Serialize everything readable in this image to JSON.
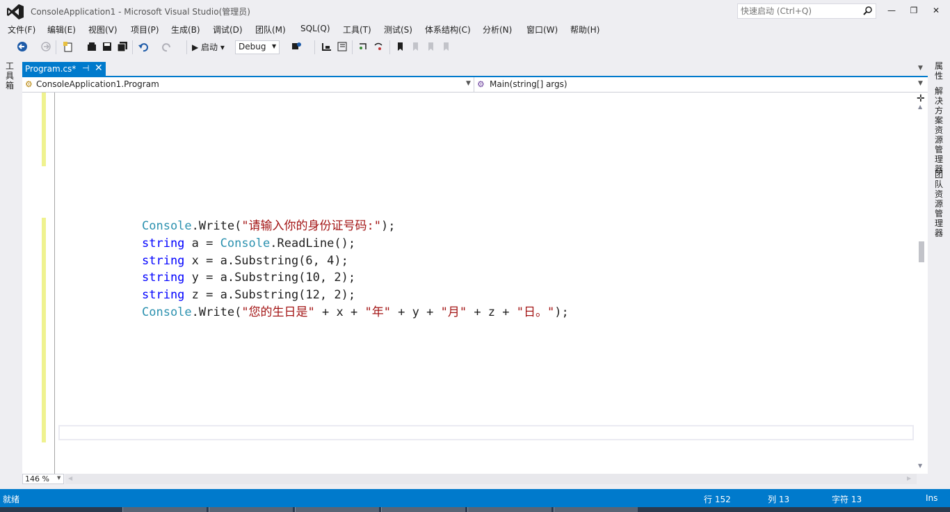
{
  "window": {
    "title": "ConsoleApplication1 - Microsoft Visual Studio(管理员)",
    "quick_launch_placeholder": "快速启动 (Ctrl+Q)",
    "minimize": "—",
    "restore": "❐",
    "close": "✕"
  },
  "menu": [
    "文件(F)",
    "编辑(E)",
    "视图(V)",
    "项目(P)",
    "生成(B)",
    "调试(D)",
    "团队(M)",
    "SQL(Q)",
    "工具(T)",
    "测试(S)",
    "体系结构(C)",
    "分析(N)",
    "窗口(W)",
    "帮助(H)"
  ],
  "toolbar": {
    "start_label": "▶ 启动 ▾",
    "configuration": "Debug"
  },
  "left_strip": {
    "toolbox": "工具箱"
  },
  "right_strip": {
    "properties": "属性",
    "solution_explorer": "解决方案资源管理器",
    "team_explorer": "团队资源管理器"
  },
  "tab": {
    "label": "Program.cs*",
    "pin": "⊣",
    "close": "✕"
  },
  "navbar": {
    "type": "ConsoleApplication1.Program",
    "member": "Main(string[] args)"
  },
  "code_lines": [
    [
      {
        "t": "Console",
        "c": "type"
      },
      {
        "t": ".Write(",
        "c": ""
      },
      {
        "t": "\"请输入你的身份证号码:\"",
        "c": "str"
      },
      {
        "t": ");",
        "c": ""
      }
    ],
    [
      {
        "t": "string",
        "c": "kw"
      },
      {
        "t": " a = ",
        "c": ""
      },
      {
        "t": "Console",
        "c": "type"
      },
      {
        "t": ".ReadLine();",
        "c": ""
      }
    ],
    [
      {
        "t": "string",
        "c": "kw"
      },
      {
        "t": " x = a.Substring(6, 4);",
        "c": ""
      }
    ],
    [
      {
        "t": "string",
        "c": "kw"
      },
      {
        "t": " y = a.Substring(10, 2);",
        "c": ""
      }
    ],
    [
      {
        "t": "string",
        "c": "kw"
      },
      {
        "t": " z = a.Substring(12, 2);",
        "c": ""
      }
    ],
    [
      {
        "t": "Console",
        "c": "type"
      },
      {
        "t": ".Write(",
        "c": ""
      },
      {
        "t": "\"您的生日是\"",
        "c": "str"
      },
      {
        "t": " + x + ",
        "c": ""
      },
      {
        "t": "\"年\"",
        "c": "str"
      },
      {
        "t": " + y + ",
        "c": ""
      },
      {
        "t": "\"月\"",
        "c": "str"
      },
      {
        "t": " + z + ",
        "c": ""
      },
      {
        "t": "\"日。\"",
        "c": "str"
      },
      {
        "t": ");",
        "c": ""
      }
    ]
  ],
  "zoom": "146 %",
  "status": {
    "ready": "就绪",
    "line": "行 152",
    "column": "列 13",
    "char": "字符 13",
    "mode": "Ins"
  },
  "colors": {
    "accent": "#007acc",
    "keyword": "#0000ff",
    "type": "#2b91af",
    "string": "#a31515",
    "change_bar": "#eff28f"
  }
}
